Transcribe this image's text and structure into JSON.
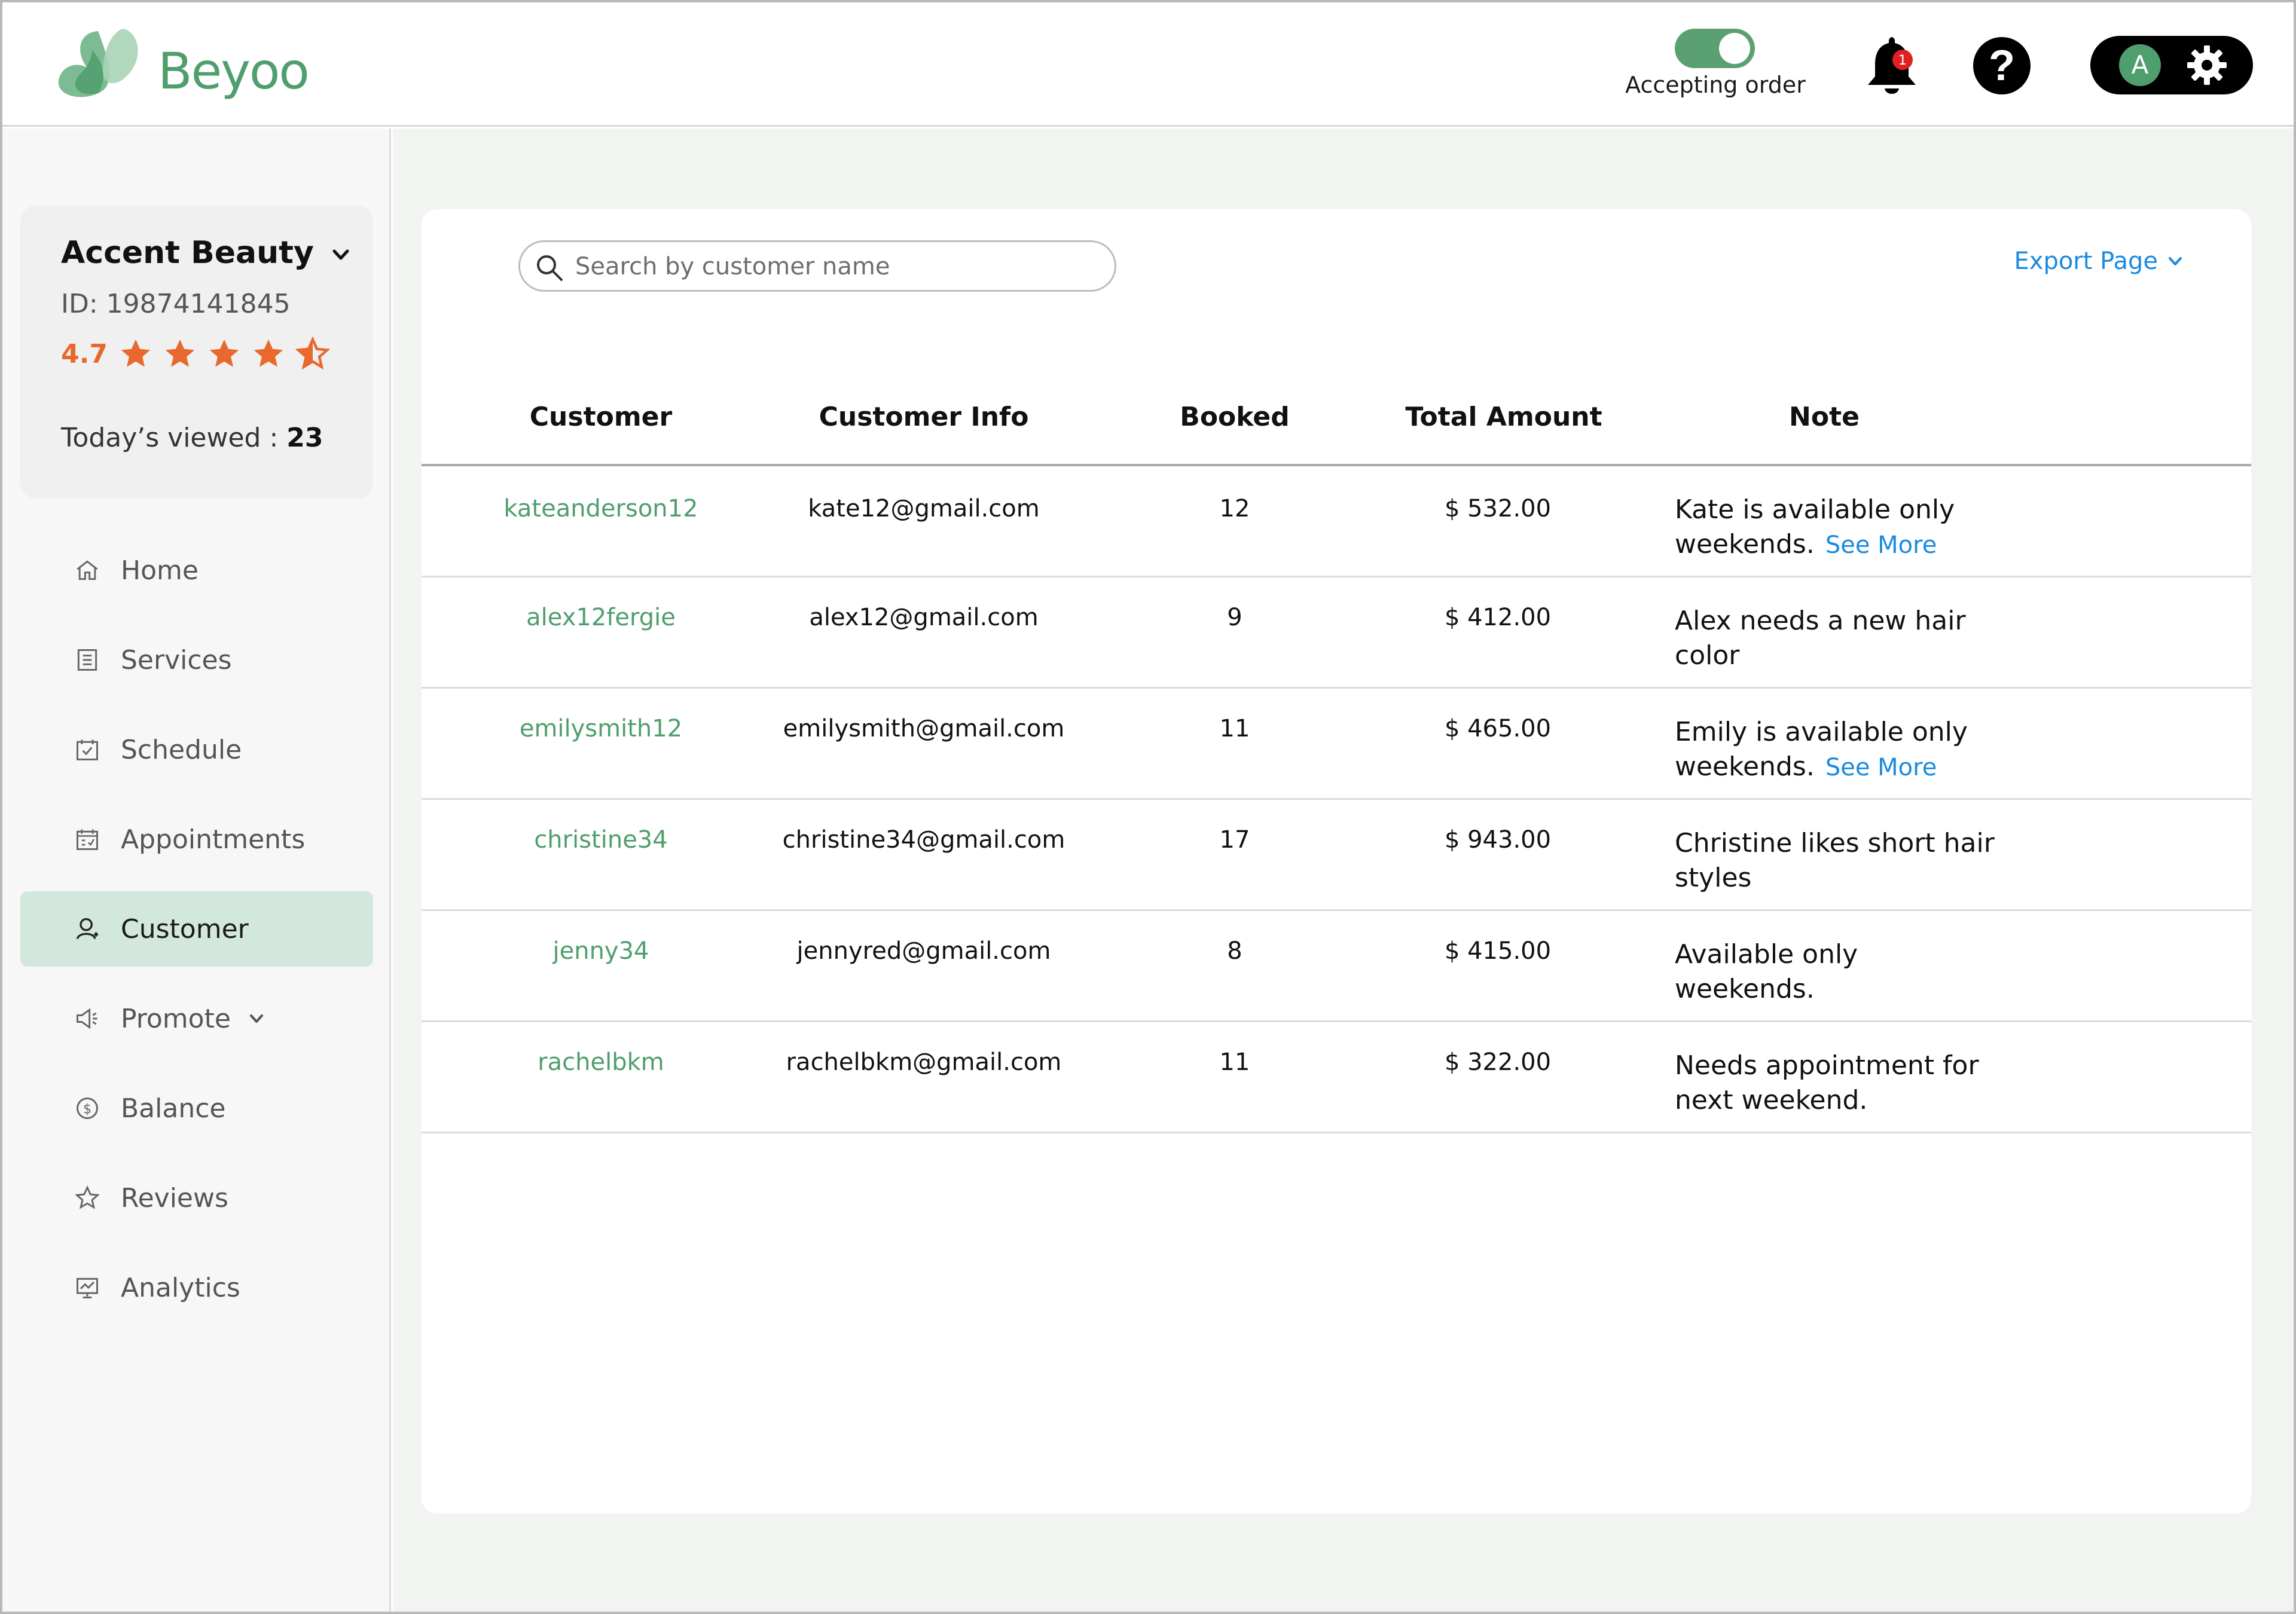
{
  "brand": {
    "name": "Beyoo",
    "color": "#4f9e6d"
  },
  "header": {
    "toggle_label": "Accepting order",
    "toggle_on": true,
    "notification_count": "1",
    "help_symbol": "?",
    "avatar_initial": "A"
  },
  "business": {
    "name": "Accent Beauty",
    "id": "ID: 19874141845",
    "rating": "4.7",
    "stars": 4.5,
    "viewed_label": "Today’s viewed : ",
    "viewed_count": "23"
  },
  "nav": {
    "items": [
      {
        "label": "Home",
        "icon": "home-icon"
      },
      {
        "label": "Services",
        "icon": "list-icon"
      },
      {
        "label": "Schedule",
        "icon": "calendar-check-icon"
      },
      {
        "label": "Appointments",
        "icon": "calendar-icon"
      },
      {
        "label": "Customer",
        "icon": "user-icon",
        "active": true
      },
      {
        "label": "Promote",
        "icon": "megaphone-icon",
        "has_submenu": true
      },
      {
        "label": "Balance",
        "icon": "dollar-icon"
      },
      {
        "label": "Reviews",
        "icon": "star-icon"
      },
      {
        "label": "Analytics",
        "icon": "chart-icon"
      }
    ]
  },
  "main": {
    "search_placeholder": "Search by customer name",
    "export_label": "Export Page",
    "table": {
      "headers": [
        "Customer",
        "Customer Info",
        "Booked",
        "Total Amount",
        "Note"
      ],
      "rows": [
        {
          "customer": "kateanderson12",
          "info": "kate12@gmail.com",
          "booked": "12",
          "amount": "$ 532.00",
          "note_line1": "Kate is available only",
          "note_line2": "weekends.",
          "see_more": "See More"
        },
        {
          "customer": "alex12fergie",
          "info": "alex12@gmail.com",
          "booked": "9",
          "amount": "$ 412.00",
          "note_line1": "Alex needs a new hair",
          "note_line2": "color",
          "see_more": ""
        },
        {
          "customer": "emilysmith12",
          "info": "emilysmith@gmail.com",
          "booked": "11",
          "amount": "$ 465.00",
          "note_line1": "Emily is available only",
          "note_line2": "weekends.",
          "see_more": "See More"
        },
        {
          "customer": "christine34",
          "info": "christine34@gmail.com",
          "booked": "17",
          "amount": "$ 943.00",
          "note_line1": "Christine likes short hair",
          "note_line2": "styles",
          "see_more": ""
        },
        {
          "customer": "jenny34",
          "info": "jennyred@gmail.com",
          "booked": "8",
          "amount": "$ 415.00",
          "note_line1": "Available only",
          "note_line2": "weekends.",
          "see_more": ""
        },
        {
          "customer": "rachelbkm",
          "info": "rachelbkm@gmail.com",
          "booked": "11",
          "amount": "$ 322.00",
          "note_line1": "Needs appointment for",
          "note_line2": "next weekend.",
          "see_more": ""
        }
      ]
    }
  },
  "colors": {
    "accent": "#4f9e6d",
    "link": "#1a8be0",
    "star": "#e8682d",
    "active_nav": "#d3e8dc",
    "badge": "#e02020"
  }
}
